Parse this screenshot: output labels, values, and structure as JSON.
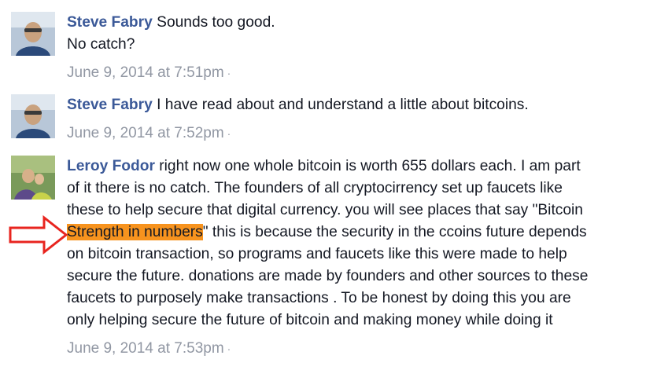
{
  "comments": [
    {
      "author": "Steve Fabry",
      "text_lines": [
        "Sounds too good.",
        "No catch?"
      ],
      "timestamp": "June 9, 2014 at 7:51pm",
      "separator": "·"
    },
    {
      "author": "Steve Fabry",
      "text": "I have read about and understand a little about bitcoins.",
      "timestamp": "June 9, 2014 at 7:52pm",
      "separator": "·"
    },
    {
      "author": "Leroy Fodor",
      "line1": "right now one whole bitcoin is worth 655 dollars each. I am part",
      "line2": "of it there is no catch. The founders of all cryptocirrency set up faucets like",
      "line3": "these to help secure that digital currency. you will see places that say \"Bitcoin",
      "highlight": "Strength in numbers",
      "line4_rest": "\" this is because the security in the ccoins future depends",
      "line5": "on bitcoin transaction, so programs and faucets like this were made to help",
      "line6": "secure the future. donations are made by founders and other sources to these",
      "line7": "faucets to purposely make transactions . To be honest by doing this you are",
      "line8": "only helping secure the future of bitcoin and making money while doing it",
      "timestamp": "June 9, 2014 at 7:53pm",
      "separator": "·"
    }
  ],
  "colors": {
    "author": "#3b5998",
    "meta": "#9197a3",
    "highlight": "#f7931e",
    "arrow": "#e8251f"
  },
  "icons": {
    "annotation": "red-outline-right-arrow-icon"
  }
}
